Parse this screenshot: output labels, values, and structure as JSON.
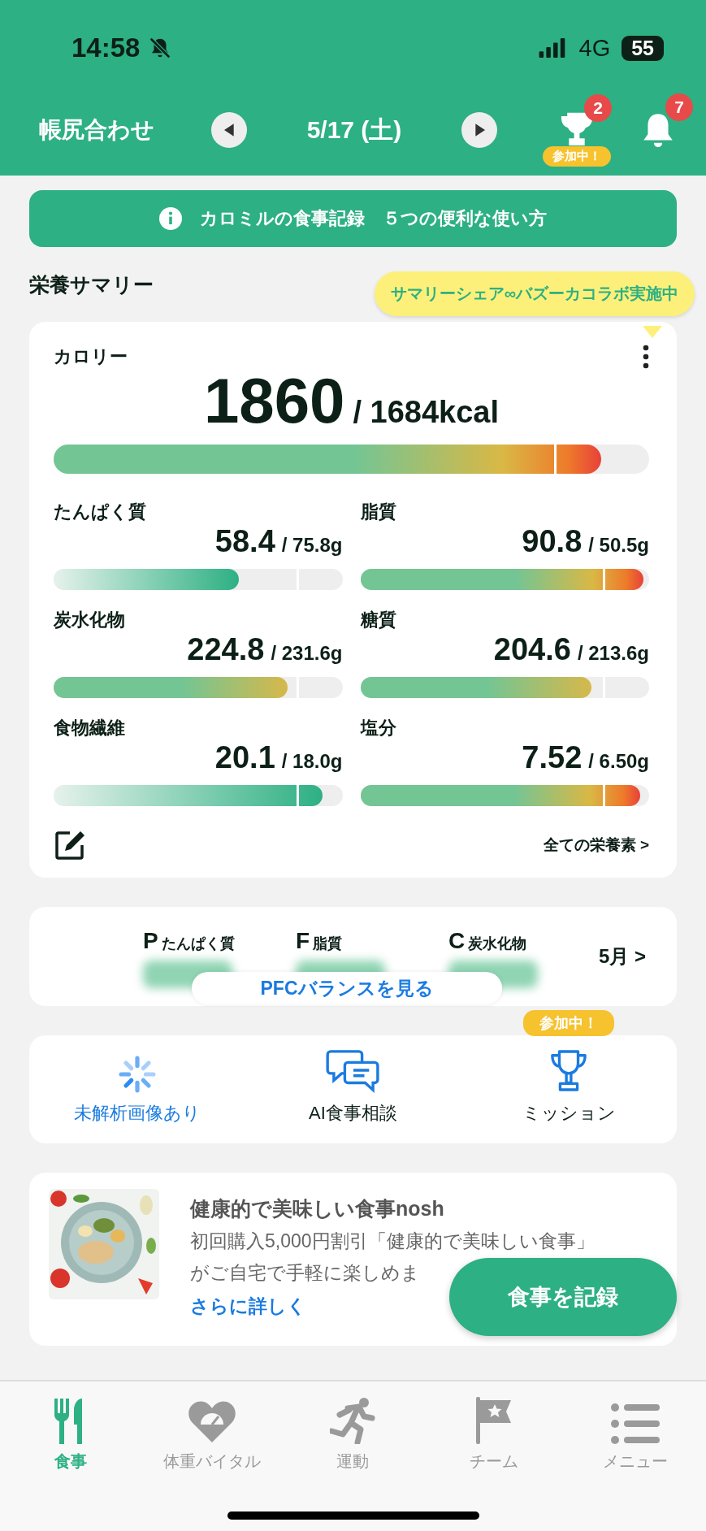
{
  "status_bar": {
    "time": "14:58",
    "network": "4G",
    "battery": "55"
  },
  "header": {
    "title": "帳尻合わせ",
    "date": "5/17 (土)",
    "trophy_badge": "2",
    "trophy_tag": "参加中！",
    "bell_badge": "7"
  },
  "info_banner": {
    "text": "カロミルの食事記録　５つの便利な使い方"
  },
  "summary": {
    "title": "栄養サマリー",
    "tooltip": "サマリーシェア∞バズーカコラボ実施中",
    "calorie": {
      "label": "カロリー",
      "value": "1860",
      "target": "/ 1684kcal",
      "level": 0.92,
      "kind": "over"
    },
    "nutrients": [
      {
        "label": "たんぱく質",
        "value": "58.4",
        "target": "/ 75.8g",
        "level": 0.64,
        "kind": "low"
      },
      {
        "label": "脂質",
        "value": "90.8",
        "target": "/ 50.5g",
        "level": 0.98,
        "kind": "over"
      },
      {
        "label": "炭水化物",
        "value": "224.8",
        "target": "/ 231.6g",
        "level": 0.81,
        "kind": "ok"
      },
      {
        "label": "糖質",
        "value": "204.6",
        "target": "/ 213.6g",
        "level": 0.8,
        "kind": "ok"
      },
      {
        "label": "食物繊維",
        "value": "20.1",
        "target": "/ 18.0g",
        "level": 0.93,
        "kind": "low"
      },
      {
        "label": "塩分",
        "value": "7.52",
        "target": "/ 6.50g",
        "level": 0.97,
        "kind": "over"
      }
    ],
    "all_link": "全ての栄養素 >"
  },
  "pfc": {
    "items": [
      {
        "letter": "P",
        "label": "たんぱく質"
      },
      {
        "letter": "F",
        "label": "脂質"
      },
      {
        "letter": "C",
        "label": "炭水化物"
      }
    ],
    "button": "PFCバランスを見る",
    "month_link": "5月 >"
  },
  "actions": [
    {
      "label": "未解析画像あり",
      "kind": "pending"
    },
    {
      "label": "AI食事相談",
      "kind": "chat"
    },
    {
      "label": "ミッション",
      "kind": "mission",
      "tag": "参加中！"
    }
  ],
  "ad": {
    "title": "健康的で美味しい食事nosh",
    "lines": [
      "初回購入5,000円割引「健康的で美味しい食事」",
      "がご自宅で手軽に楽しめま"
    ],
    "link": "さらに詳しく"
  },
  "record_button": "食事を記録",
  "tabs": [
    {
      "label": "食事",
      "kind": "meal",
      "selected": true
    },
    {
      "label": "体重バイタル",
      "kind": "weight",
      "selected": false
    },
    {
      "label": "運動",
      "kind": "exercise",
      "selected": false
    },
    {
      "label": "チーム",
      "kind": "team",
      "selected": false
    },
    {
      "label": "メニュー",
      "kind": "menu",
      "selected": false
    }
  ]
}
